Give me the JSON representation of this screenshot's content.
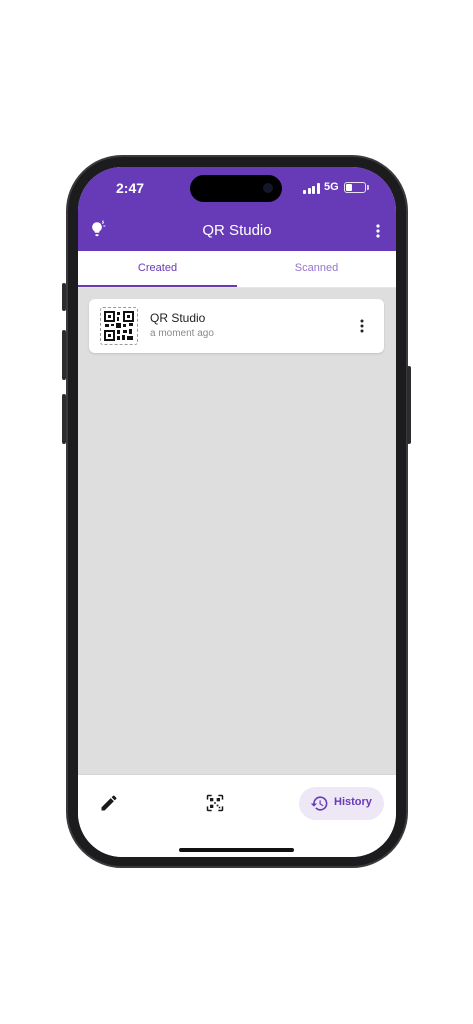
{
  "status_bar": {
    "time": "2:47",
    "network": "5G",
    "battery_level": 0.35
  },
  "app_bar": {
    "title": "QR Studio",
    "leading_icon": "lightbulb-icon",
    "trailing_icon": "more-vert-icon"
  },
  "tabs": [
    {
      "label": "Created",
      "selected": true
    },
    {
      "label": "Scanned",
      "selected": false
    }
  ],
  "items": [
    {
      "title": "QR Studio",
      "subtitle": "a moment ago",
      "icon": "qr-code-icon"
    }
  ],
  "bottom_nav": {
    "edit_icon": "pencil-icon",
    "scan_icon": "qr-scan-icon",
    "history": {
      "label": "History",
      "icon": "history-icon",
      "selected": true
    }
  },
  "colors": {
    "primary": "#673ab7",
    "primary_light": "#9575cd",
    "pill_bg": "#ede7f6",
    "background": "#dedede"
  }
}
